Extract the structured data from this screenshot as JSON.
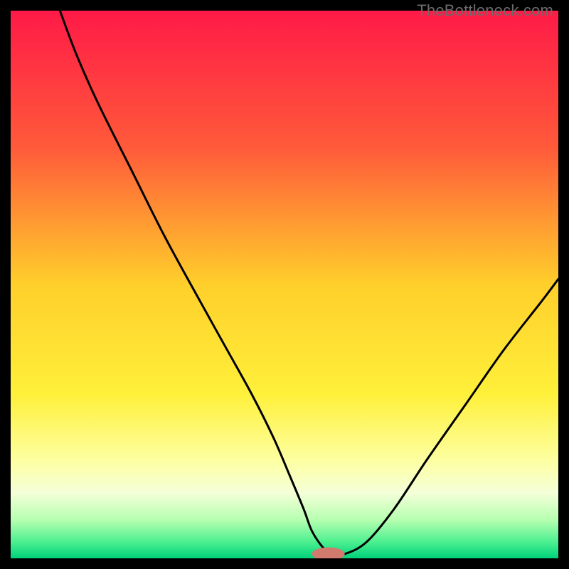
{
  "watermark": "TheBottleneck.com",
  "chart_data": {
    "type": "line",
    "title": "",
    "xlabel": "",
    "ylabel": "",
    "xlim": [
      0,
      100
    ],
    "ylim": [
      0,
      100
    ],
    "grid": false,
    "background_gradient": {
      "stops": [
        {
          "offset": 0.0,
          "color": "#ff1a47"
        },
        {
          "offset": 0.25,
          "color": "#ff5a3a"
        },
        {
          "offset": 0.5,
          "color": "#ffcf2b"
        },
        {
          "offset": 0.7,
          "color": "#fff03a"
        },
        {
          "offset": 0.82,
          "color": "#fdffa0"
        },
        {
          "offset": 0.88,
          "color": "#f5ffd8"
        },
        {
          "offset": 0.93,
          "color": "#b6ffb0"
        },
        {
          "offset": 0.97,
          "color": "#4cf090"
        },
        {
          "offset": 1.0,
          "color": "#00d27a"
        }
      ]
    },
    "series": [
      {
        "name": "bottleneck-curve",
        "x": [
          9,
          12,
          16,
          22,
          28,
          34,
          39,
          44,
          48,
          51,
          53.5,
          55,
          57,
          58.5,
          61,
          65,
          70,
          76,
          83,
          90,
          97,
          100
        ],
        "values": [
          100,
          92,
          83,
          71,
          59,
          48,
          39,
          30,
          22,
          15,
          9,
          5,
          2,
          0.8,
          0.8,
          3,
          9,
          18,
          28,
          38,
          47,
          51
        ]
      }
    ],
    "marker": {
      "name": "min-indicator",
      "x": 58,
      "y": 0.8,
      "rx": 3.0,
      "ry": 1.2,
      "color": "#d27a6e"
    }
  }
}
